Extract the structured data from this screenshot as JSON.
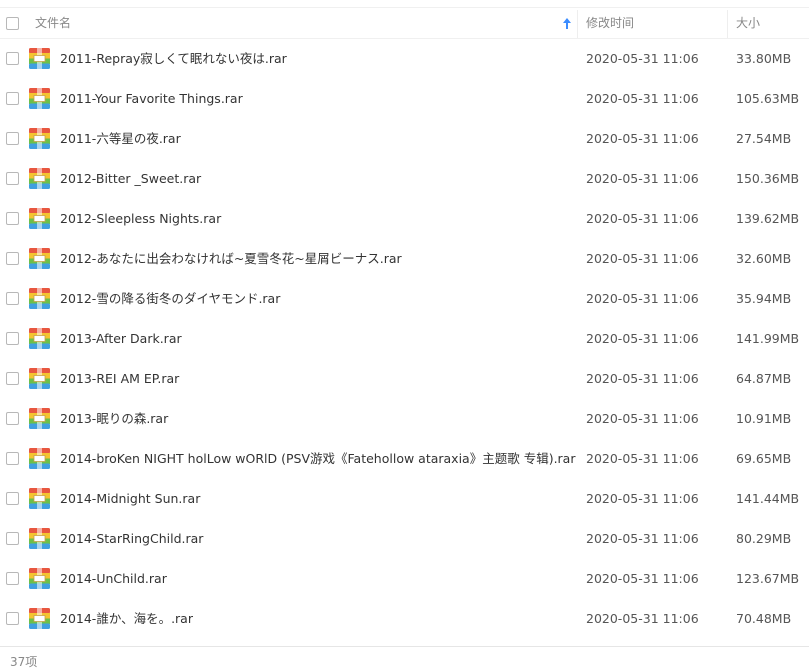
{
  "header": {
    "name_label": "文件名",
    "time_label": "修改时间",
    "size_label": "大小",
    "sort_icon": "sort-ascending-arrow-icon"
  },
  "colors": {
    "accent": "#3b8cff",
    "icon_red": "#e8563f",
    "icon_yellow": "#f4c430",
    "icon_green": "#6cc04a",
    "icon_blue": "#3f9fe0"
  },
  "file_icon": "rar-archive-icon",
  "files": [
    {
      "name": "2011-Repray寂しくて眠れない夜は.rar",
      "date": "2020-05-31 11:06",
      "size": "33.80MB"
    },
    {
      "name": "2011-Your Favorite Things.rar",
      "date": "2020-05-31 11:06",
      "size": "105.63MB"
    },
    {
      "name": "2011-六等星の夜.rar",
      "date": "2020-05-31 11:06",
      "size": "27.54MB"
    },
    {
      "name": "2012-Bitter _Sweet.rar",
      "date": "2020-05-31 11:06",
      "size": "150.36MB"
    },
    {
      "name": "2012-Sleepless Nights.rar",
      "date": "2020-05-31 11:06",
      "size": "139.62MB"
    },
    {
      "name": "2012-あなたに出会わなければ~夏雪冬花~星屑ビーナス.rar",
      "date": "2020-05-31 11:06",
      "size": "32.60MB"
    },
    {
      "name": "2012-雪の降る街冬のダイヤモンド.rar",
      "date": "2020-05-31 11:06",
      "size": "35.94MB"
    },
    {
      "name": "2013-After Dark.rar",
      "date": "2020-05-31 11:06",
      "size": "141.99MB"
    },
    {
      "name": "2013-REI AM EP.rar",
      "date": "2020-05-31 11:06",
      "size": "64.87MB"
    },
    {
      "name": "2013-眠りの森.rar",
      "date": "2020-05-31 11:06",
      "size": "10.91MB"
    },
    {
      "name": "2014-broKen NIGHT  holLow wORlD (PSV游戏《Fatehollow ataraxia》主题歌 专辑).rar",
      "date": "2020-05-31 11:06",
      "size": "69.65MB"
    },
    {
      "name": "2014-Midnight Sun.rar",
      "date": "2020-05-31 11:06",
      "size": "141.44MB"
    },
    {
      "name": "2014-StarRingChild.rar",
      "date": "2020-05-31 11:06",
      "size": "80.29MB"
    },
    {
      "name": "2014-UnChild.rar",
      "date": "2020-05-31 11:06",
      "size": "123.67MB"
    },
    {
      "name": "2014-誰か、海を。.rar",
      "date": "2020-05-31 11:06",
      "size": "70.48MB"
    }
  ],
  "footer": {
    "count_label": "37项"
  }
}
